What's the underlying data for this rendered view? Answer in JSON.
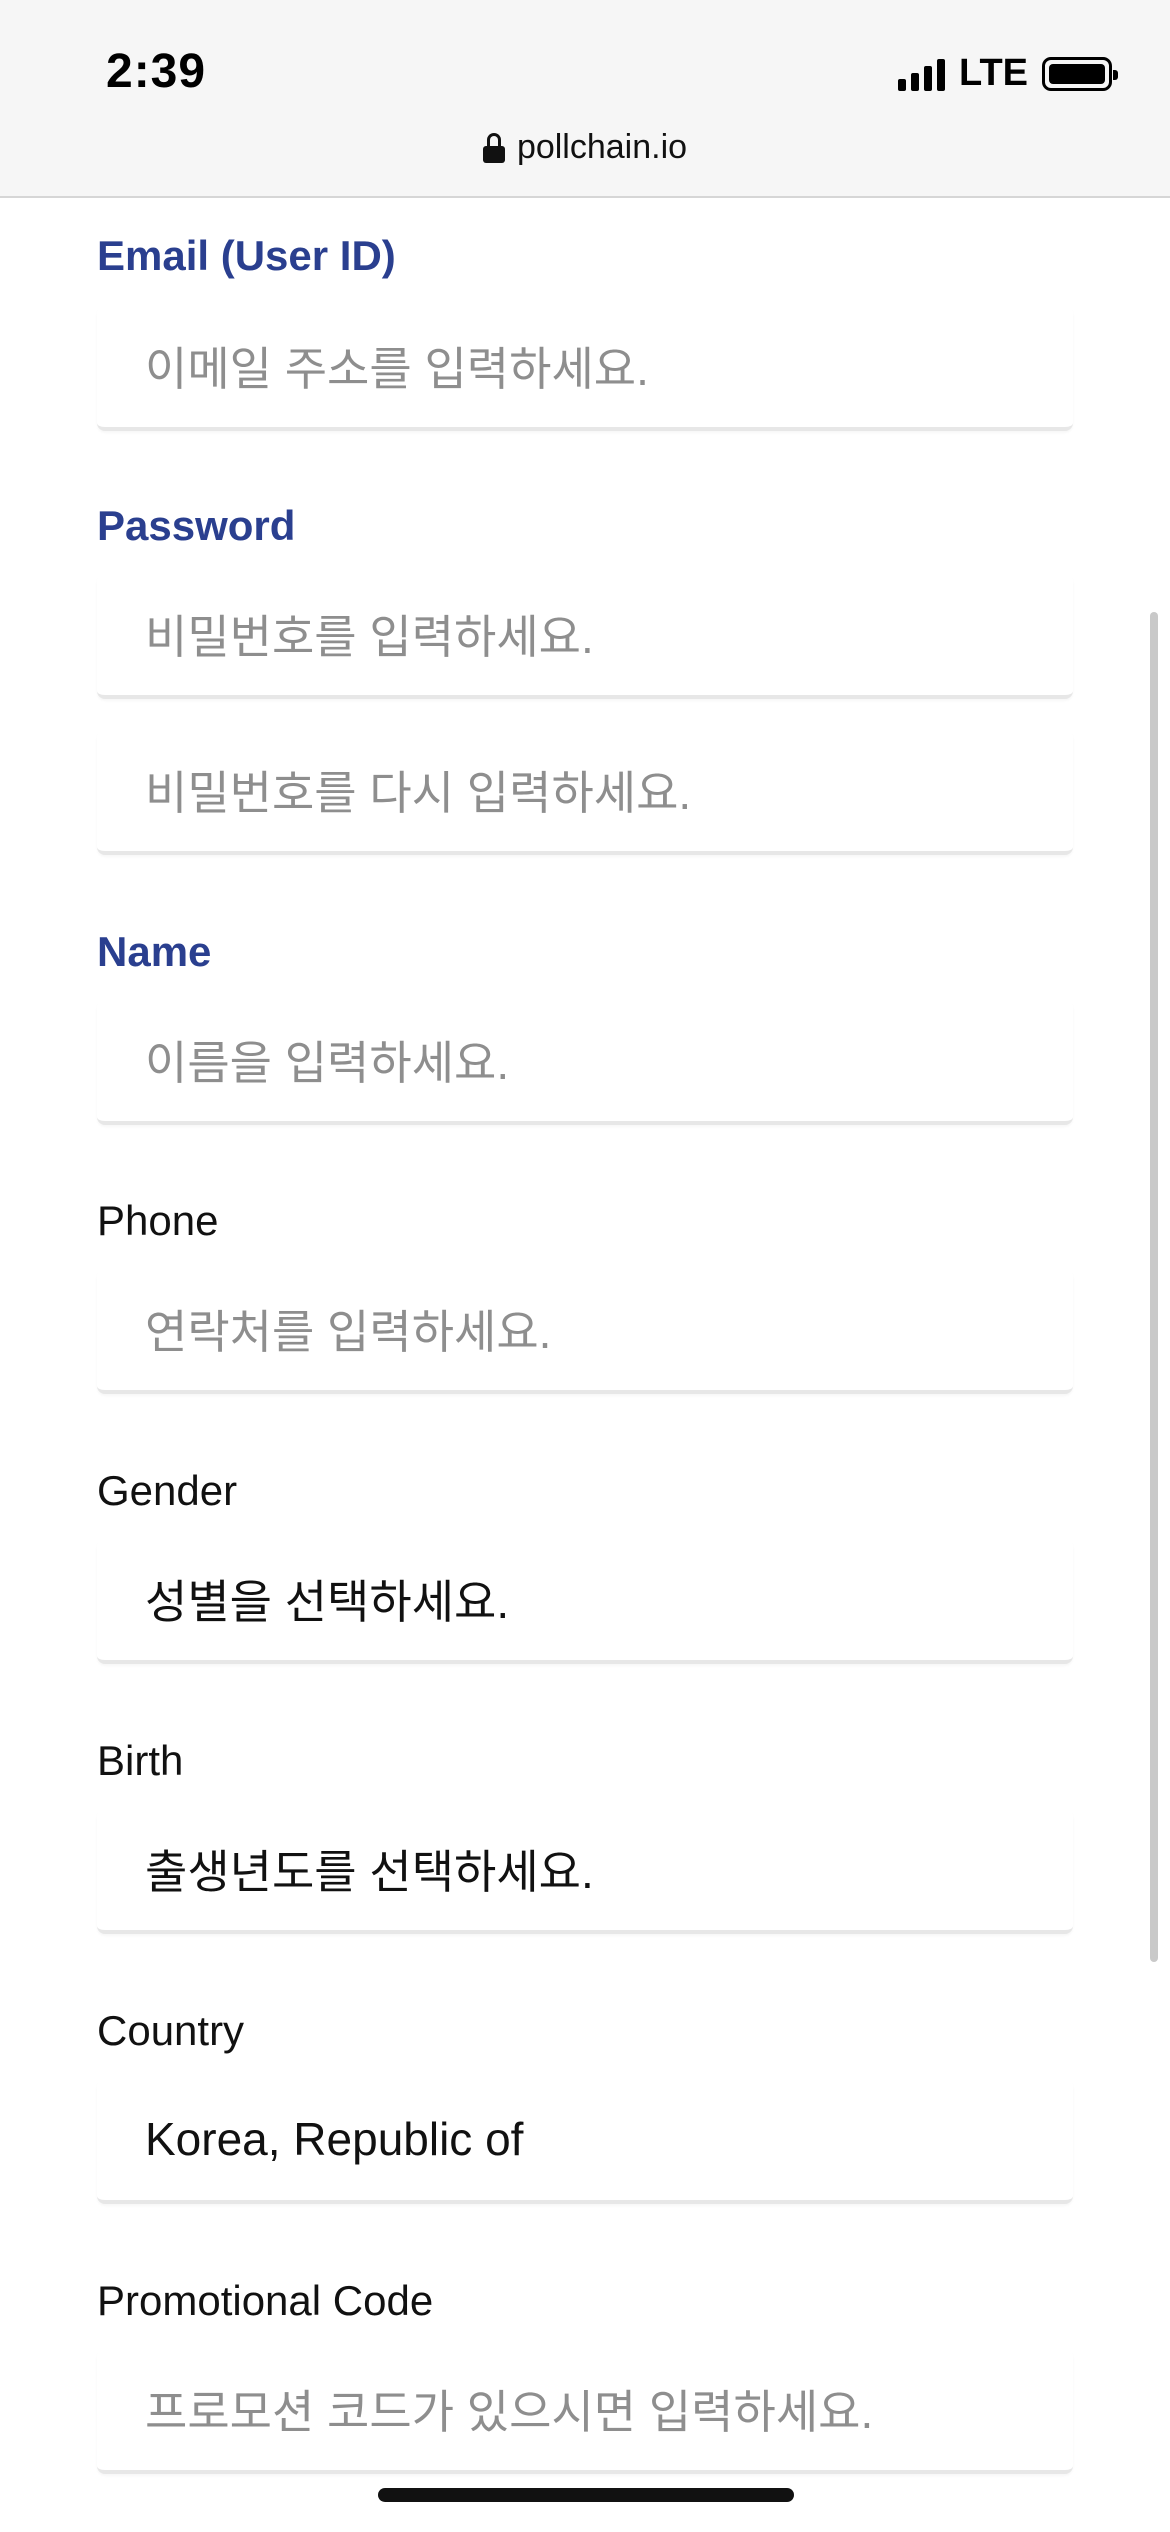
{
  "status_bar": {
    "time": "2:39",
    "network": "LTE",
    "url": "pollchain.io"
  },
  "form": {
    "email": {
      "label": "Email (User ID)",
      "placeholder": "이메일 주소를 입력하세요."
    },
    "password": {
      "label": "Password",
      "placeholder": "비밀번호를 입력하세요.",
      "confirm_placeholder": "비밀번호를 다시 입력하세요."
    },
    "name": {
      "label": "Name",
      "placeholder": "이름을 입력하세요."
    },
    "phone": {
      "label": "Phone",
      "placeholder": "연락처를 입력하세요."
    },
    "gender": {
      "label": "Gender",
      "value": "성별을 선택하세요."
    },
    "birth": {
      "label": "Birth",
      "value": "출생년도를 선택하세요."
    },
    "country": {
      "label": "Country",
      "value": "Korea, Republic of"
    },
    "promo": {
      "label": "Promotional Code",
      "placeholder": "프로모션 코드가 있으시면 입력하세요."
    }
  },
  "colors": {
    "required_label": "#2a3f8f",
    "placeholder": "#8e8e8e"
  }
}
